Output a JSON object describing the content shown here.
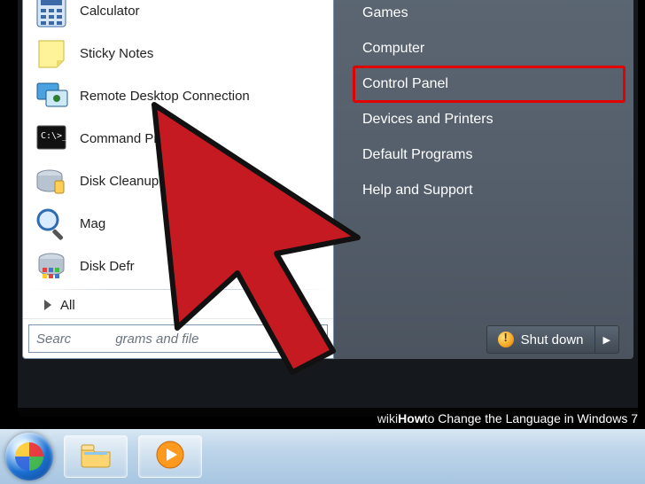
{
  "programs": [
    {
      "id": "calculator",
      "label": "Calculator",
      "icon": "calculator-icon"
    },
    {
      "id": "sticky-notes",
      "label": "Sticky Notes",
      "icon": "sticky-notes-icon"
    },
    {
      "id": "remote-desktop",
      "label": "Remote Desktop Connection",
      "icon": "remote-desktop-icon"
    },
    {
      "id": "command-prompt",
      "label": "Command Prompt",
      "icon": "command-prompt-icon"
    },
    {
      "id": "disk-cleanup",
      "label": "Disk Cleanup",
      "icon": "disk-cleanup-icon"
    },
    {
      "id": "magnifier",
      "label": "Mag",
      "icon": "magnifier-icon"
    },
    {
      "id": "disk-defrag",
      "label": "Disk Defr",
      "icon": "disk-defrag-icon"
    }
  ],
  "all_programs_label": "All",
  "search": {
    "placeholder": "Search programs and files",
    "visible": "Searc            grams and file"
  },
  "right_items": [
    {
      "id": "games",
      "label": "Games"
    },
    {
      "id": "computer",
      "label": "Computer"
    },
    {
      "id": "control-panel",
      "label": "Control Panel",
      "highlight": true
    },
    {
      "id": "devices-printers",
      "label": "Devices and Printers"
    },
    {
      "id": "default-programs",
      "label": "Default Programs"
    },
    {
      "id": "help-support",
      "label": "Help and Support"
    }
  ],
  "shutdown": {
    "label": "Shut down"
  },
  "taskbar": {
    "items": [
      "explorer-icon",
      "media-player-icon"
    ]
  },
  "caption": {
    "brand": "wikiHow",
    "bold": "How",
    "rest": " to Change the Language in Windows 7"
  },
  "colors": {
    "highlight": "#e30000"
  }
}
